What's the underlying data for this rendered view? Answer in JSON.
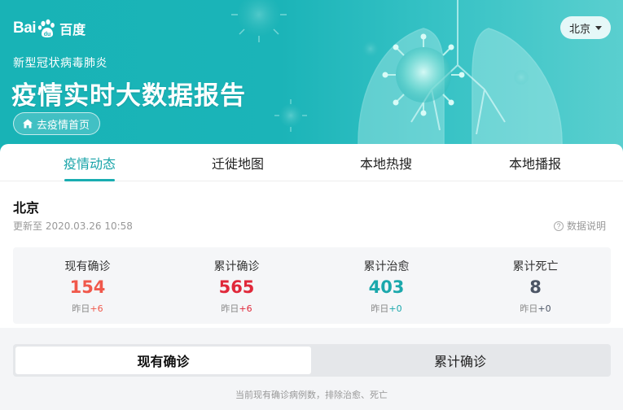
{
  "header": {
    "logo_left": "Bai",
    "logo_right": "百度",
    "subtitle": "新型冠状病毒肺炎",
    "title": "疫情实时大数据报告",
    "home_button": "去疫情首页",
    "city_select": "北京"
  },
  "tabs": [
    {
      "label": "疫情动态",
      "active": true
    },
    {
      "label": "迁徙地图",
      "active": false
    },
    {
      "label": "本地热搜",
      "active": false
    },
    {
      "label": "本地播报",
      "active": false
    }
  ],
  "region": {
    "name": "北京",
    "updated": "更新至 2020.03.26 10:58",
    "data_note": "数据说明"
  },
  "stats": [
    {
      "label": "现有确诊",
      "value": "154",
      "delta_prefix": "昨日",
      "delta": "+6",
      "color": "#f0584b",
      "delta_color": "#f0584b"
    },
    {
      "label": "累计确诊",
      "value": "565",
      "delta_prefix": "昨日",
      "delta": "+6",
      "color": "#e0283a",
      "delta_color": "#e0283a"
    },
    {
      "label": "累计治愈",
      "value": "403",
      "delta_prefix": "昨日",
      "delta": "+0",
      "color": "#1ba8ac",
      "delta_color": "#1ba8ac"
    },
    {
      "label": "累计死亡",
      "value": "8",
      "delta_prefix": "昨日",
      "delta": "+0",
      "color": "#4c5565",
      "delta_color": "#4c5565"
    }
  ],
  "toggle": {
    "options": [
      {
        "label": "现有确诊",
        "active": true
      },
      {
        "label": "累计确诊",
        "active": false
      }
    ],
    "footnote": "当前现有确诊病例数，排除治愈、死亡"
  }
}
